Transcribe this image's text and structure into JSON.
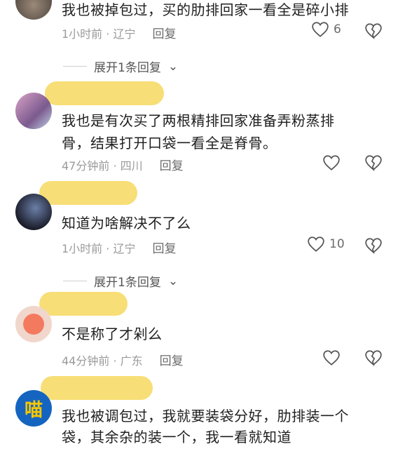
{
  "comments": [
    {
      "text_lines": [
        "我也被掉包过，买的肋排回家一看全是碎小排"
      ],
      "time": "1小时前 · 辽宁",
      "reply": "回复",
      "likes": "6"
    },
    {
      "text_lines": [
        "我也是有次买了两根精排回家准备弄粉蒸排",
        "骨，结果打开口袋一看全是脊骨。"
      ],
      "time": "47分钟前 · 四川",
      "reply": "回复",
      "likes": ""
    },
    {
      "text_lines": [
        "知道为啥解决不了么"
      ],
      "time": "1小时前 · 辽宁",
      "reply": "回复",
      "likes": "10"
    },
    {
      "text_lines": [
        "不是称了才剁么"
      ],
      "time": "44分钟前 · 广东",
      "reply": "回复",
      "likes": ""
    },
    {
      "text_lines": [
        "我也被调包过，我就要装袋分好，肋排装一个",
        "袋，其余杂的装一个，我一看就知道"
      ],
      "avatar_text": "喵"
    }
  ],
  "expand_replies": [
    "展开1条回复",
    "展开1条回复"
  ],
  "colors": {
    "blur": "#f7dc6f",
    "meta": "#9a9a9a"
  }
}
